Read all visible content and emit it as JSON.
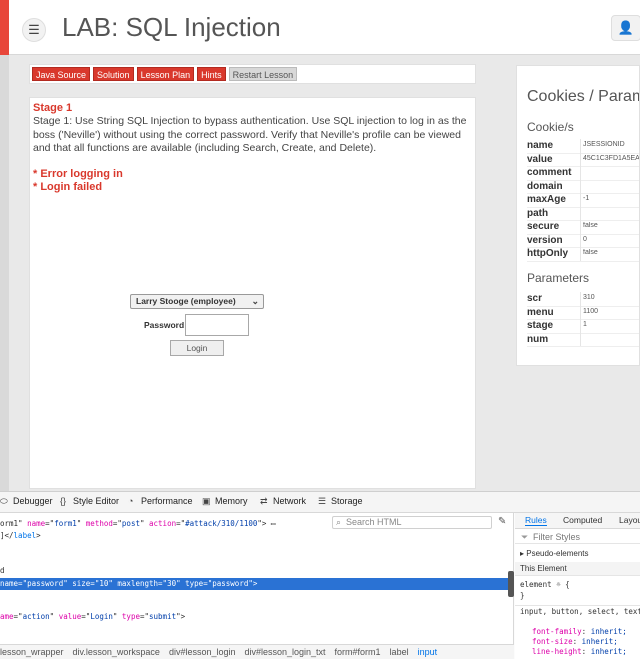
{
  "header": {
    "title": "LAB: SQL Injection",
    "menu_icon": "hamburger-icon",
    "user_icon": "user-icon"
  },
  "toolbar": {
    "buttons": [
      "Java Source",
      "Solution",
      "Lesson Plan",
      "Hints",
      "Restart Lesson"
    ]
  },
  "lesson": {
    "stage_title": "Stage 1",
    "stage_desc": "Stage 1: Use String SQL Injection to bypass authentication. Use SQL injection to log in as the boss ('Neville') without using the correct password. Verify that Neville's profile can be viewed and that all functions are available (including Search, Create, and Delete).",
    "errors": [
      "* Error logging in",
      "* Login failed"
    ],
    "employee_selected": "Larry Stooge (employee)",
    "password_label": "Password",
    "password_value": "",
    "login_button": "Login"
  },
  "cookies": {
    "title": "Cookies / Parameters",
    "cookies_heading": "Cookie/s",
    "cookie_rows": [
      {
        "key": "name",
        "value": "JSESSIONID"
      },
      {
        "key": "value",
        "value": "45C1C3FD1A5EA"
      },
      {
        "key": "comment",
        "value": ""
      },
      {
        "key": "domain",
        "value": ""
      },
      {
        "key": "maxAge",
        "value": "-1"
      },
      {
        "key": "path",
        "value": ""
      },
      {
        "key": "secure",
        "value": "false"
      },
      {
        "key": "version",
        "value": "0"
      },
      {
        "key": "httpOnly",
        "value": "false"
      }
    ],
    "params_heading": "Parameters",
    "param_rows": [
      {
        "key": "scr",
        "value": "310"
      },
      {
        "key": "menu",
        "value": "1100"
      },
      {
        "key": "stage",
        "value": "1"
      },
      {
        "key": "num",
        "value": ""
      }
    ]
  },
  "devtools": {
    "tabs": [
      {
        "label": "Debugger",
        "icon": "debugger-icon",
        "glyph": "⬭"
      },
      {
        "label": "Style Editor",
        "icon": "style-editor-icon",
        "glyph": "{}"
      },
      {
        "label": "Performance",
        "icon": "performance-icon",
        "glyph": "◔"
      },
      {
        "label": "Memory",
        "icon": "memory-icon",
        "glyph": "▣"
      },
      {
        "label": "Network",
        "icon": "network-icon",
        "glyph": "⇄"
      },
      {
        "label": "Storage",
        "icon": "storage-icon",
        "glyph": "☰"
      }
    ],
    "search_placeholder": "Search HTML",
    "code_lines": [
      {
        "parts": [
          [
            "",
            "orm1\" "
          ],
          [
            "a",
            "name"
          ],
          [
            "",
            "=\""
          ],
          [
            "v",
            "form1"
          ],
          [
            "",
            "\" "
          ],
          [
            "a",
            "method"
          ],
          [
            "",
            "=\""
          ],
          [
            "v",
            "post"
          ],
          [
            "",
            "\" "
          ],
          [
            "a",
            "action"
          ],
          [
            "",
            "=\""
          ],
          [
            "v",
            "#attack/310/1100"
          ],
          [
            "",
            "\"> ▭"
          ]
        ]
      },
      {
        "parts": [
          [
            "",
            "]</"
          ],
          [
            "t",
            "label"
          ],
          [
            "",
            ">"
          ]
        ]
      },
      {
        "parts": [
          [
            "",
            ""
          ]
        ]
      },
      {
        "parts": [
          [
            "",
            "d"
          ]
        ]
      },
      {
        "parts": [
          [
            "",
            "name=\"password\" size=\"10\" maxlength=\"30\" type=\"password\">"
          ]
        ],
        "selected": true
      },
      {
        "parts": [
          [
            "",
            ""
          ]
        ]
      },
      {
        "parts": [
          [
            "",
            ""
          ]
        ]
      },
      {
        "parts": [
          [
            "a",
            "ame"
          ],
          [
            "",
            "=\""
          ],
          [
            "v",
            "action"
          ],
          [
            "",
            "\" "
          ],
          [
            "a",
            "value"
          ],
          [
            "",
            "=\""
          ],
          [
            "v",
            "Login"
          ],
          [
            "",
            "\" "
          ],
          [
            "a",
            "type"
          ],
          [
            "",
            "=\""
          ],
          [
            "v",
            "submit"
          ],
          [
            "",
            "\">"
          ]
        ]
      }
    ],
    "breadcrumbs": [
      "lesson_wrapper",
      "div.lesson_workspace",
      "div#lesson_login",
      "div#lesson_login_txt",
      "form#form1",
      "label",
      "input"
    ],
    "rules_tabs": [
      "Rules",
      "Computed",
      "Layout"
    ],
    "filter_placeholder": "Filter Styles",
    "pseudo_label": "▸ Pseudo-elements",
    "this_element_label": "This Element",
    "element_rule_open": "element ☼ {",
    "element_rule_close": "}",
    "inherit_selector": "input, button, select, textarea ☼ {",
    "inherit_props": [
      {
        "name": "font-family",
        "value": "inherit;"
      },
      {
        "name": "font-size",
        "value": "inherit;"
      },
      {
        "name": "line-height",
        "value": "inherit;"
      }
    ]
  }
}
